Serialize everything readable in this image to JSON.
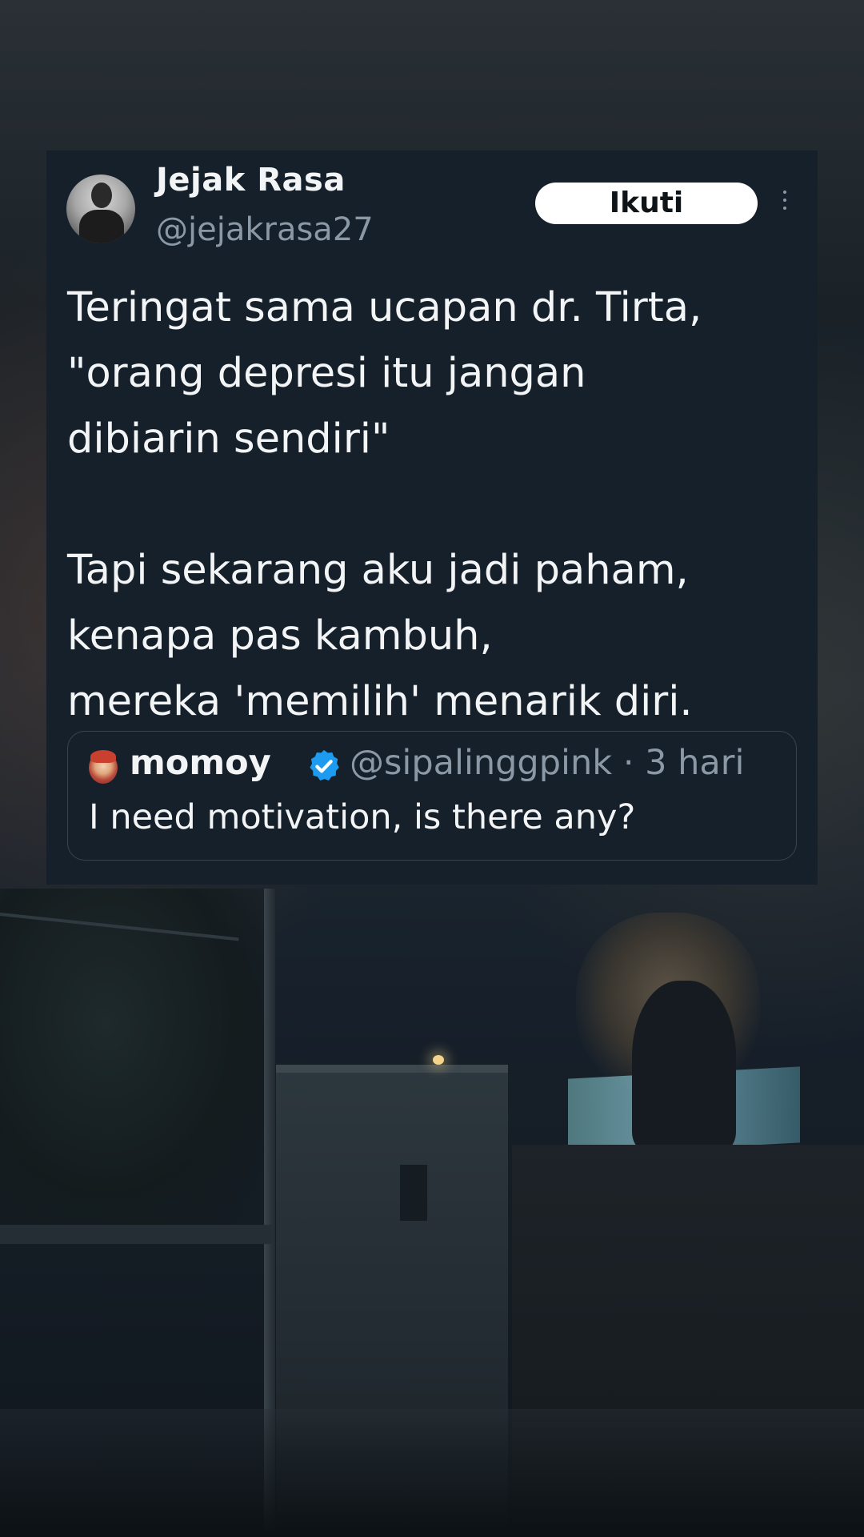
{
  "tweet": {
    "author_name": "Jejak Rasa",
    "author_handle": "@jejakrasa27",
    "follow_label": "Ikuti",
    "body": "Teringat sama ucapan dr. Tirta,\n\"orang depresi itu jangan\ndibiarin sendiri\"\n\nTapi sekarang aku jadi paham,\nkenapa pas kambuh,\nmereka 'memilih' menarik diri."
  },
  "quoted_tweet": {
    "author_name": "momoy",
    "verified": true,
    "author_handle": "@sipalinggpink",
    "separator": "·",
    "timestamp": "3 hari",
    "text": "I need motivation, is there any?"
  },
  "icons": {
    "more": "more-options-icon",
    "verified": "verified-badge-icon"
  },
  "colors": {
    "card_background": "#15202b",
    "secondary_text": "#8b98a5",
    "verified_blue": "#1d9bf0"
  }
}
